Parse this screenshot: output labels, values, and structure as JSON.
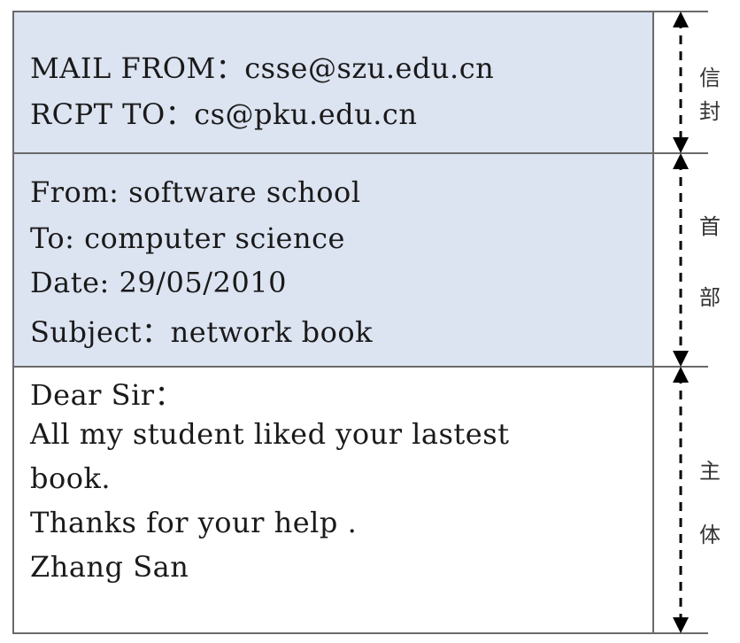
{
  "envelope": {
    "lines": [
      "MAIL FROM：csse@szu.edu.cn",
      "RCPT TO：cs@pku.edu.cn"
    ],
    "label": [
      "信",
      "封"
    ]
  },
  "header": {
    "lines": [
      "From: software school",
      "To: computer science",
      "Date: 29/05/2010",
      "Subject：network book"
    ],
    "label": [
      "首",
      "部"
    ]
  },
  "body": {
    "lines": [
      "Dear Sir：",
      "All my student liked your lastest",
      "book.",
      "Thanks for your help .",
      "Zhang San"
    ],
    "label": [
      "主",
      "体"
    ]
  }
}
